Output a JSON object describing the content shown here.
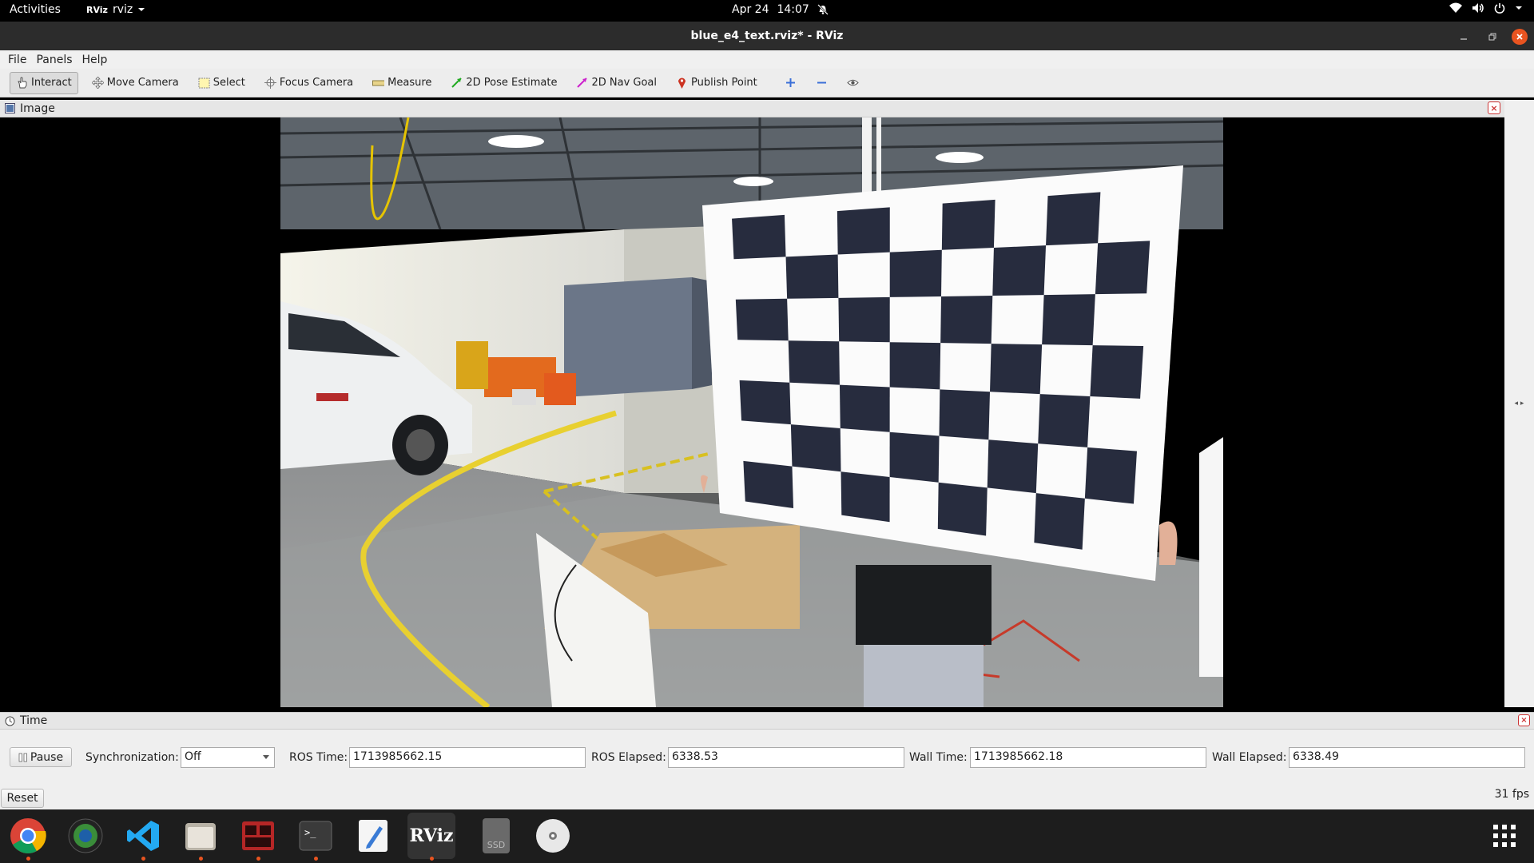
{
  "topbar": {
    "activities": "Activities",
    "app_menu": "rviz",
    "app_logo": "RViz",
    "date": "Apr 24",
    "time": "14:07",
    "icons": [
      "bell-muted-icon",
      "wifi-icon",
      "volume-icon",
      "power-icon",
      "chevron-down-icon"
    ]
  },
  "window": {
    "title": "blue_e4_text.rviz* - RViz"
  },
  "menubar": {
    "items": [
      "File",
      "Panels",
      "Help"
    ]
  },
  "toolbar": {
    "tools": [
      "Interact",
      "Move Camera",
      "Select",
      "Focus Camera",
      "Measure",
      "2D Pose Estimate",
      "2D Nav Goal",
      "Publish Point"
    ],
    "active": "Interact",
    "colors": {
      "pose": "#22aa22",
      "nav": "#cc22cc",
      "point": "#cc3322",
      "plus": "#3a6fd8"
    }
  },
  "image_panel": {
    "title": "Image"
  },
  "time_panel": {
    "title": "Time",
    "pause_label": "Pause",
    "sync_label": "Synchronization:",
    "sync_value": "Off",
    "ros_time_label": "ROS Time:",
    "ros_time": "1713985662.15",
    "ros_elapsed_label": "ROS Elapsed:",
    "ros_elapsed": "6338.53",
    "wall_time_label": "Wall Time:",
    "wall_time": "1713985662.18",
    "wall_elapsed_label": "Wall Elapsed:",
    "wall_elapsed": "6338.49",
    "reset_label": "Reset",
    "fps": "31 fps"
  },
  "dock": {
    "apps": [
      "chrome-icon",
      "color-picker-icon",
      "vscode-icon",
      "files-icon",
      "terminator-icon",
      "terminal-icon",
      "text-editor-icon",
      "rviz-icon",
      "ssd-icon",
      "disc-icon",
      "app-grid-icon"
    ],
    "rviz_label": "RViz",
    "ssd_label": "SSD",
    "terminal_prompt": ">_"
  }
}
